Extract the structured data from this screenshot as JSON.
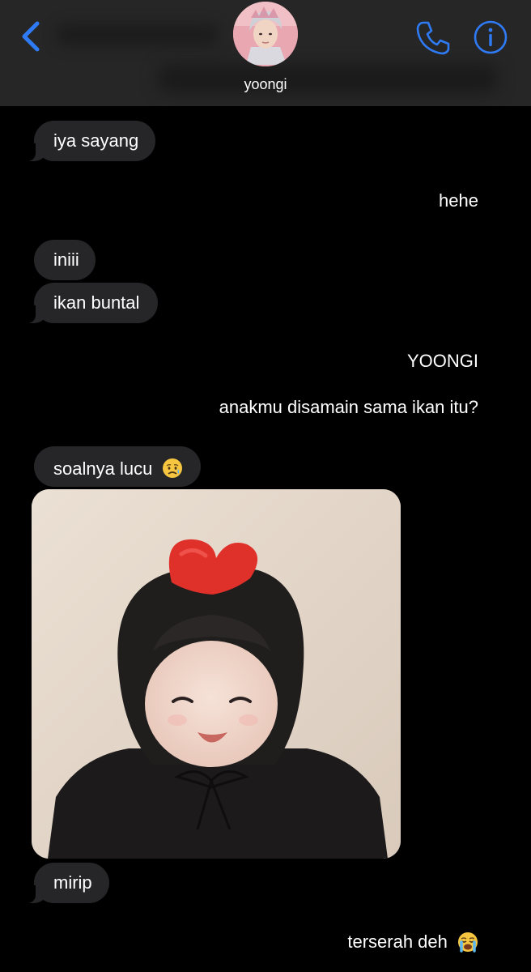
{
  "header": {
    "contact_name": "yoongi",
    "back_icon": "chevron-left-icon",
    "call_icon": "phone-icon",
    "info_icon": "info-icon",
    "accent_color": "#2f7bf6"
  },
  "messages": [
    {
      "side": "incoming",
      "text": "iya sayang"
    },
    {
      "side": "outgoing",
      "text": "hehe"
    },
    {
      "side": "incoming",
      "text": "iniii"
    },
    {
      "side": "incoming",
      "text": "ikan buntal"
    },
    {
      "side": "outgoing",
      "text": "YOONGI"
    },
    {
      "side": "outgoing",
      "text": "anakmu disamain sama ikan itu?"
    },
    {
      "side": "incoming",
      "text": "soalnya lucu",
      "emoji": "sad-relieved-emoji"
    },
    {
      "side": "incoming",
      "type": "photo",
      "content": "photo-baby-heart-hat"
    },
    {
      "side": "incoming",
      "text": "mirip"
    },
    {
      "side": "outgoing",
      "text": "terserah deh",
      "emoji": "loudly-crying-emoji"
    }
  ],
  "colors": {
    "incoming_bubble": "#262628",
    "header_bg": "#262626",
    "background": "#000000"
  }
}
